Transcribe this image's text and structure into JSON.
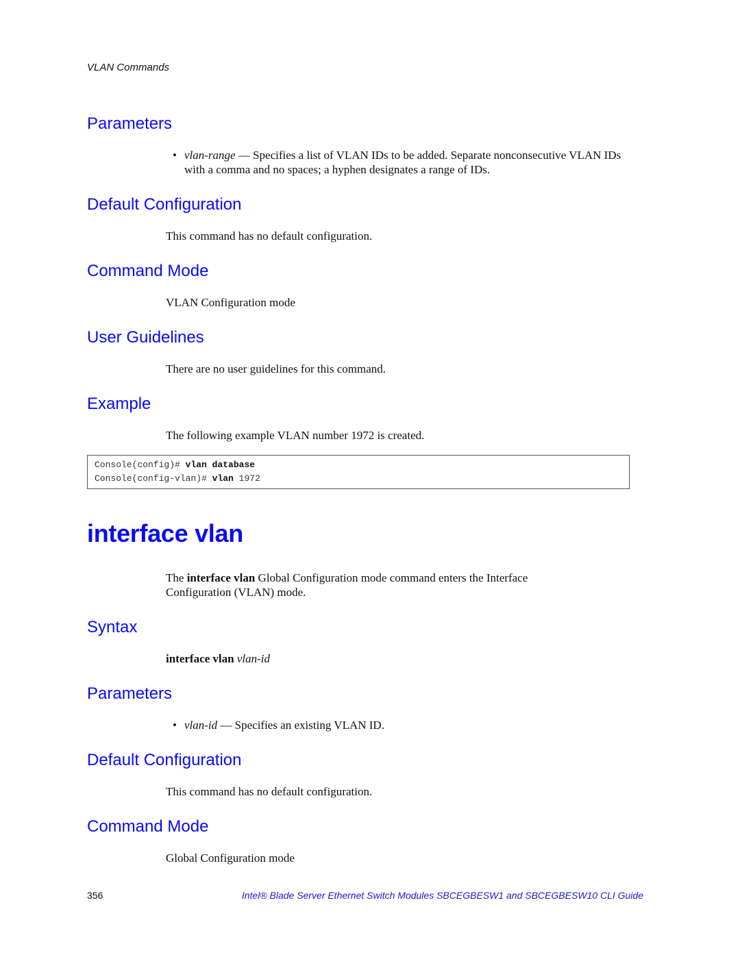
{
  "running_header": "VLAN Commands",
  "sections_top": {
    "parameters_heading": "Parameters",
    "parameters_bullet_term": "vlan-range",
    "parameters_bullet_text": " — Specifies a list of VLAN IDs to be added. Separate nonconsecutive VLAN IDs with a comma and no spaces; a hyphen designates a range of IDs.",
    "default_config_heading": "Default Configuration",
    "default_config_text": "This command has no default configuration.",
    "command_mode_heading": "Command Mode",
    "command_mode_text": "VLAN Configuration mode",
    "user_guidelines_heading": "User Guidelines",
    "user_guidelines_text": "There are no user guidelines for this command.",
    "example_heading": "Example",
    "example_text": "The following example VLAN number 1972 is created."
  },
  "code_example": {
    "line1_prompt": "Console(config)# ",
    "line1_cmd": "vlan database",
    "line2_prompt": "Console(config-vlan)# ",
    "line2_cmd": "vlan",
    "line2_arg": " 1972"
  },
  "command": {
    "title": "interface vlan",
    "intro_prefix": "The ",
    "intro_bold": "interface vlan",
    "intro_suffix": " Global Configuration mode command enters the Interface Configuration (VLAN) mode.",
    "syntax_heading": "Syntax",
    "syntax_bold": "interface vlan",
    "syntax_italic": "vlan-id",
    "parameters_heading": "Parameters",
    "parameters_bullet_term": "vlan-id",
    "parameters_bullet_text": " — Specifies an existing VLAN ID.",
    "default_config_heading": "Default Configuration",
    "default_config_text": "This command has no default configuration.",
    "command_mode_heading": "Command Mode",
    "command_mode_text": "Global Configuration mode"
  },
  "footer": {
    "page_number": "356",
    "doc_title": "Intel® Blade Server Ethernet Switch Modules SBCEGBESW1 and SBCEGBESW10 CLI Guide"
  },
  "colors": {
    "heading": "#0a0af5",
    "footer_title": "#1a1ad0"
  }
}
